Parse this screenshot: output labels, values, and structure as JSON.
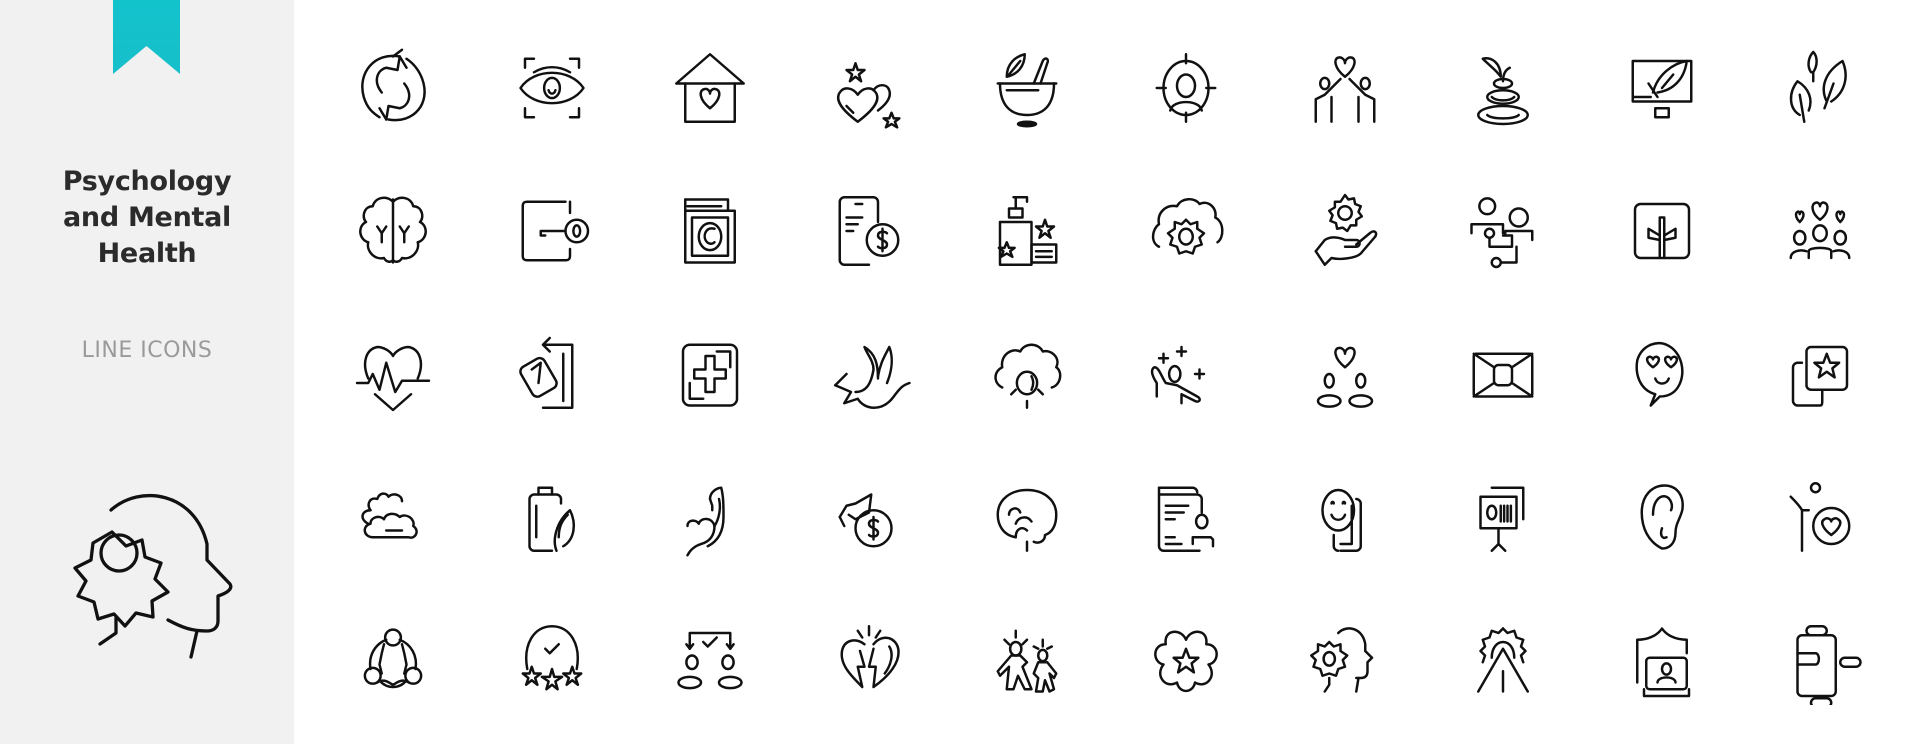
{
  "sidebar": {
    "title_lines": [
      "Psychology",
      "and Mental",
      "Health"
    ],
    "subtitle": "LINE ICONS",
    "ribbon_color": "#17c1cb",
    "background_color": "#f1f1f1",
    "hero_icon": "head-gear-icon"
  },
  "icon_grid": {
    "columns": 10,
    "rows": 5,
    "stroke_color": "#111111",
    "icons": [
      {
        "name": "cycle-arrows-icon",
        "label": "Cycle"
      },
      {
        "name": "eye-scan-icon",
        "label": "Eye scan"
      },
      {
        "name": "house-heart-icon",
        "label": "Home with heart"
      },
      {
        "name": "hearts-stars-icon",
        "label": "Hearts and stars"
      },
      {
        "name": "mortar-pestle-icon",
        "label": "Mortar and pestle"
      },
      {
        "name": "target-person-icon",
        "label": "Target person"
      },
      {
        "name": "people-heart-icon",
        "label": "People with heart"
      },
      {
        "name": "zen-stones-icon",
        "label": "Zen stones"
      },
      {
        "name": "monitor-leaf-icon",
        "label": "Monitor with leaf"
      },
      {
        "name": "leaves-icon",
        "label": "Leaves"
      },
      {
        "name": "brain-icon",
        "label": "Brain"
      },
      {
        "name": "key-box-icon",
        "label": "Key box"
      },
      {
        "name": "copyright-book-icon",
        "label": "Copyright book"
      },
      {
        "name": "phone-dollar-icon",
        "label": "Phone payment"
      },
      {
        "name": "lotion-stars-icon",
        "label": "Lotion with stars"
      },
      {
        "name": "cloud-gear-icon",
        "label": "Cloud gear"
      },
      {
        "name": "hand-gear-icon",
        "label": "Hand with gear"
      },
      {
        "name": "people-network-icon",
        "label": "People network"
      },
      {
        "name": "cross-box-icon",
        "label": "Cross box"
      },
      {
        "name": "group-hearts-icon",
        "label": "Group with hearts"
      },
      {
        "name": "heart-pulse-icon",
        "label": "Heart pulse"
      },
      {
        "name": "exit-door-icon",
        "label": "Exit door"
      },
      {
        "name": "medical-cross-icon",
        "label": "Medical cross"
      },
      {
        "name": "dove-icon",
        "label": "Dove"
      },
      {
        "name": "cloud-idea-icon",
        "label": "Cloud idea"
      },
      {
        "name": "happy-person-sparkle-icon",
        "label": "Happy person"
      },
      {
        "name": "couple-heart-icon",
        "label": "Couple with heart"
      },
      {
        "name": "envelope-box-icon",
        "label": "Box"
      },
      {
        "name": "love-emoji-chat-icon",
        "label": "Love emoji chat"
      },
      {
        "name": "star-cards-icon",
        "label": "Star cards"
      },
      {
        "name": "clouds-icon",
        "label": "Clouds"
      },
      {
        "name": "bottle-leaf-icon",
        "label": "Bottle with leaf"
      },
      {
        "name": "muscle-arm-icon",
        "label": "Strong arm"
      },
      {
        "name": "education-dollar-icon",
        "label": "Education cost"
      },
      {
        "name": "brain-side-icon",
        "label": "Brain side"
      },
      {
        "name": "profile-card-icon",
        "label": "Profile card"
      },
      {
        "name": "smile-phone-icon",
        "label": "Smile card"
      },
      {
        "name": "presentation-icon",
        "label": "Presentation"
      },
      {
        "name": "ear-icon",
        "label": "Ear"
      },
      {
        "name": "person-heart-icon",
        "label": "Person with heart"
      },
      {
        "name": "team-circle-icon",
        "label": "Team circle"
      },
      {
        "name": "rating-check-icon",
        "label": "Rating check"
      },
      {
        "name": "choice-people-icon",
        "label": "Choice"
      },
      {
        "name": "broken-heart-icon",
        "label": "Broken heart"
      },
      {
        "name": "walking-people-icon",
        "label": "Walking people"
      },
      {
        "name": "flower-star-icon",
        "label": "Flower star"
      },
      {
        "name": "head-gear-small-icon",
        "label": "Head with gear"
      },
      {
        "name": "gear-path-icon",
        "label": "Gear path"
      },
      {
        "name": "shield-laptop-icon",
        "label": "Shield laptop"
      },
      {
        "name": "pill-bottle-icon",
        "label": "Pill bottle"
      }
    ]
  }
}
